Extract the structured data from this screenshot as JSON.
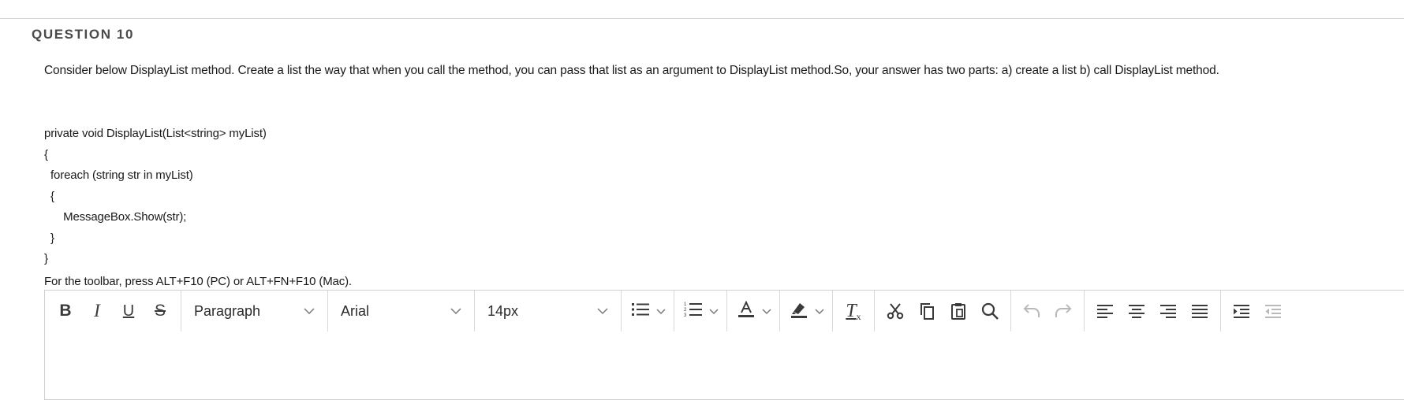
{
  "question": {
    "label": "QUESTION 10",
    "prompt": "Consider below DisplayList method. Create a list the way that when you call the method, you can pass that list as an argument to DisplayList method.So, your answer has two parts: a) create a list b) call DisplayList method.",
    "code_lines": [
      "private void DisplayList(List<string> myList)",
      "{",
      "  foreach (string str in myList)",
      "  {",
      "      MessageBox.Show(str);",
      "  }",
      "}"
    ],
    "toolbar_hint": "For the toolbar, press ALT+F10 (PC) or ALT+FN+F10 (Mac)."
  },
  "toolbar": {
    "bold": "B",
    "italic": "I",
    "underline": "U",
    "strike": "S",
    "block_format": "Paragraph",
    "font_family": "Arial",
    "font_size": "14px",
    "clear_format": "T",
    "icons": [
      "bold-icon",
      "italic-icon",
      "underline-icon",
      "strikethrough-icon",
      "bullet-list-icon",
      "numbered-list-icon",
      "text-color-icon",
      "highlight-icon",
      "clear-format-icon",
      "cut-icon",
      "copy-icon",
      "paste-icon",
      "search-icon",
      "undo-icon",
      "redo-icon",
      "align-left-icon",
      "align-center-icon",
      "align-right-icon",
      "align-justify-icon",
      "indent-icon",
      "outdent-icon"
    ]
  },
  "colors": {
    "text": "#1a1a1a",
    "border": "#cfcfcf",
    "icon": "#3a3a3a",
    "disabled_icon": "#b9b9b9"
  }
}
